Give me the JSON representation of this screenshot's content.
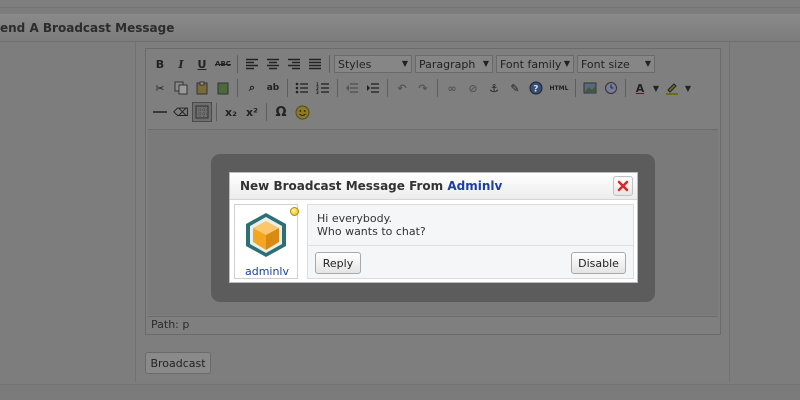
{
  "page": {
    "section_title": "end A Broadcast Message",
    "broadcast_label": "Broadcast"
  },
  "editor": {
    "toolbar": {
      "row1": [
        "bold-icon",
        "italic-icon",
        "underline-icon",
        "strikethrough-icon",
        "align-left-icon",
        "align-center-icon",
        "align-right-icon",
        "align-justify-icon"
      ],
      "styles_label": "Styles",
      "paragraph_label": "Paragraph",
      "font_family_label": "Font family",
      "font_size_label": "Font size",
      "bold": "B",
      "italic": "I",
      "underline": "U",
      "strike": "ABC",
      "subscript": "x₂",
      "superscript": "x²",
      "omega": "Ω",
      "html": "HTML",
      "font_color": "A"
    },
    "status_path": "Path: p"
  },
  "modal": {
    "title_prefix": "New Broadcast Message From",
    "sender": "Adminlv",
    "username": "adminlv",
    "message_line1": "Hi everybody.",
    "message_line2": "Who wants to chat?",
    "reply_label": "Reply",
    "disable_label": "Disable"
  },
  "colors": {
    "overlay": "#7d7d7d",
    "link_blue": "#1d3f9c",
    "close_red": "#d62b2b",
    "avatar_orange": "#f4a623",
    "avatar_teal": "#2d6f74"
  }
}
